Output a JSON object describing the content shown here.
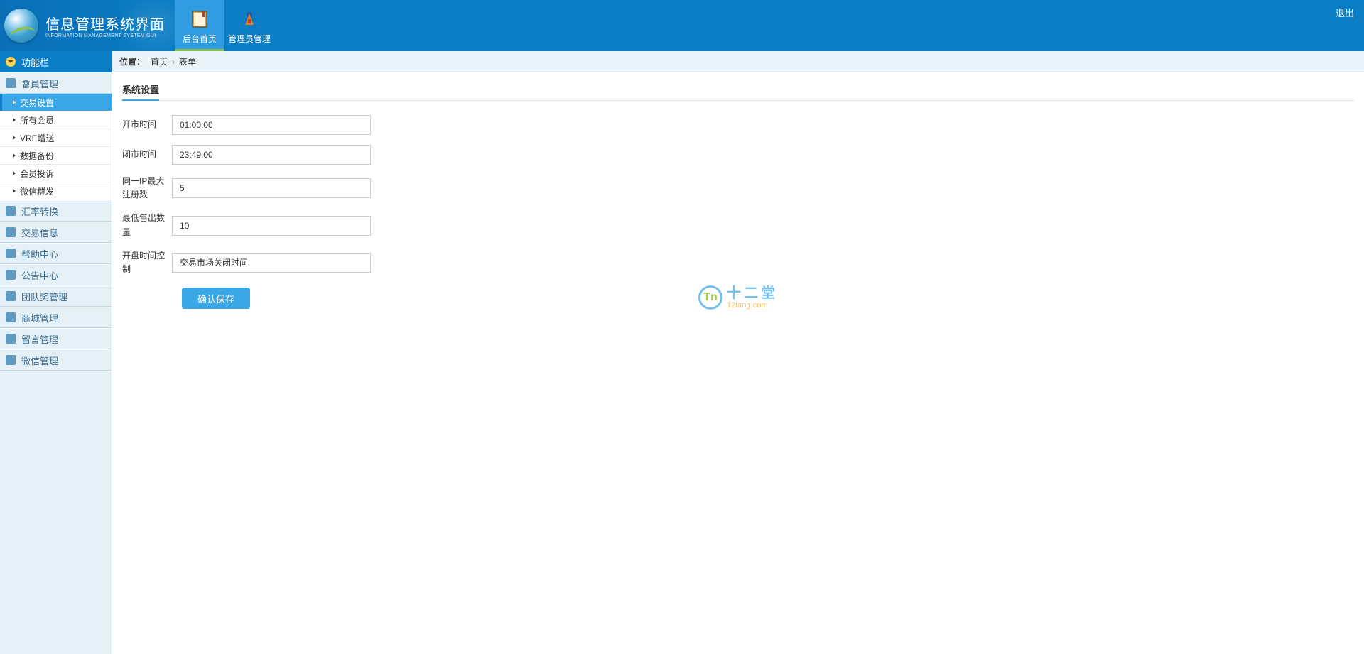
{
  "header": {
    "app_title": "信息管理系统界面",
    "app_subtitle": "INFORMATION MANAGEMENT SYSTEM GUI",
    "nav": [
      {
        "label": "后台首页",
        "name": "nav-home"
      },
      {
        "label": "管理员管理",
        "name": "nav-admin"
      }
    ],
    "logout": "退出"
  },
  "sidebar": {
    "header": "功能栏",
    "sections": [
      {
        "label": "會員管理",
        "name": "sec-member",
        "icon": "doc",
        "expanded": true,
        "items": [
          {
            "label": "交易设置",
            "name": "sub-trade-settings",
            "active": true
          },
          {
            "label": "所有会员",
            "name": "sub-all-members"
          },
          {
            "label": "VRE增送",
            "name": "sub-vre-bonus"
          },
          {
            "label": "数据备份",
            "name": "sub-backup"
          },
          {
            "label": "会员投诉",
            "name": "sub-complaints"
          },
          {
            "label": "微信群发",
            "name": "sub-wechat-broadcast"
          }
        ]
      },
      {
        "label": "汇率转换",
        "name": "sec-exchange",
        "icon": "swap"
      },
      {
        "label": "交易信息",
        "name": "sec-trade-info",
        "icon": "doc"
      },
      {
        "label": "帮助中心",
        "name": "sec-help",
        "icon": "doc"
      },
      {
        "label": "公告中心",
        "name": "sec-notice",
        "icon": "doc"
      },
      {
        "label": "团队奖管理",
        "name": "sec-team-bonus",
        "icon": "doc"
      },
      {
        "label": "商城管理",
        "name": "sec-mall",
        "icon": "doc"
      },
      {
        "label": "留言管理",
        "name": "sec-message",
        "icon": "doc"
      },
      {
        "label": "微信管理",
        "name": "sec-wechat",
        "icon": "doc"
      }
    ]
  },
  "breadcrumb": {
    "label": "位置：",
    "home": "首页",
    "sep": "›",
    "current": "表单"
  },
  "panel": {
    "title": "系统设置"
  },
  "form": {
    "fields": [
      {
        "label": "开市时间",
        "value": "01:00:00",
        "name": "open-time"
      },
      {
        "label": "闭市时间",
        "value": "23:49:00",
        "name": "close-time"
      },
      {
        "label": "同一IP最大注册数",
        "value": "5",
        "name": "max-ip-reg"
      },
      {
        "label": "最低售出数量",
        "value": "10",
        "name": "min-sell-qty"
      },
      {
        "label": "开盘时间控制",
        "value": "交易市场关闭时间",
        "name": "open-time-control"
      }
    ],
    "submit": "确认保存"
  },
  "watermark": {
    "glyph": "Tn",
    "cn": "十二堂",
    "en": "12tang.com"
  }
}
